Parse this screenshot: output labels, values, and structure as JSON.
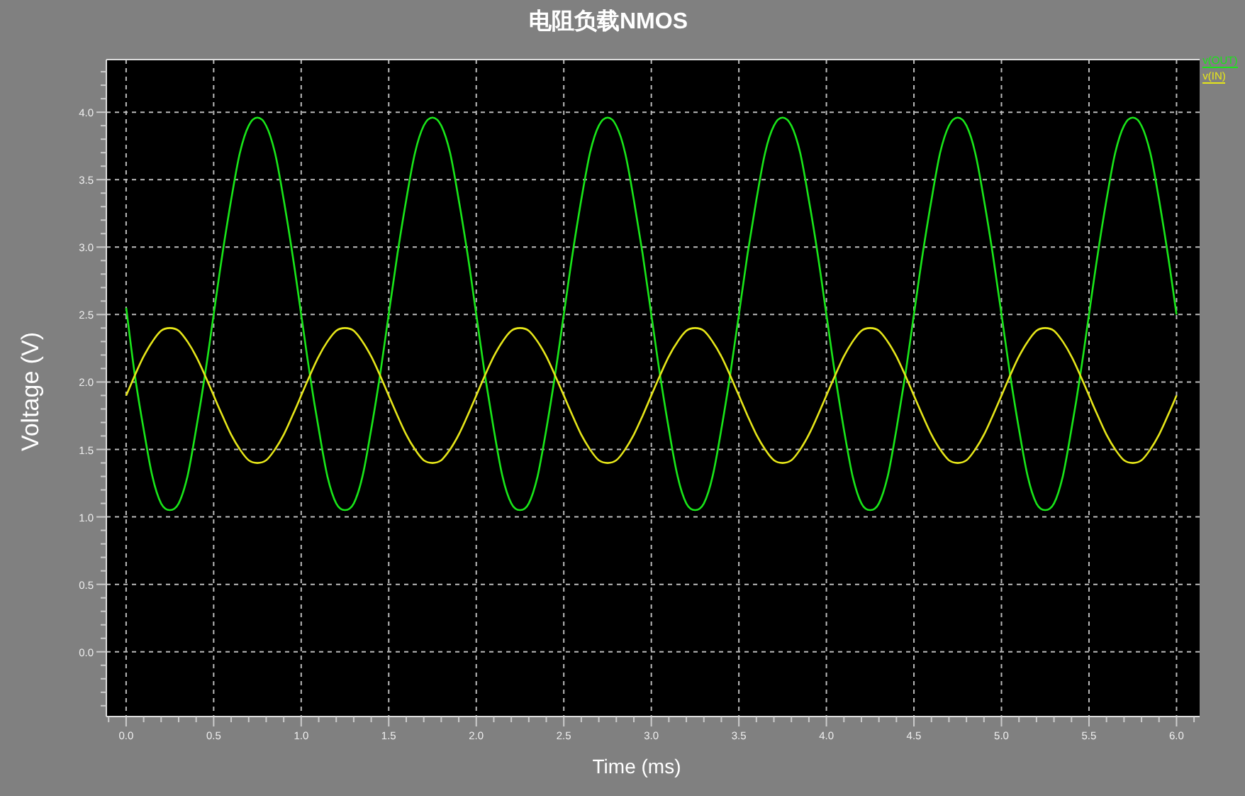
{
  "title": "电阻负载NMOS",
  "chart": {
    "chart_data": {
      "type": "line",
      "grid": true,
      "xlabel": "Time (ms)",
      "ylabel": "Voltage (V)",
      "xlim": [
        -0.113,
        6.14
      ],
      "ylim": [
        -0.48,
        4.39
      ],
      "xticks": [
        {
          "value": 0,
          "label": "0.0"
        },
        {
          "value": 0.5,
          "label": "0.5"
        },
        {
          "value": 1,
          "label": "1.0"
        },
        {
          "value": 1.5,
          "label": "1.5"
        },
        {
          "value": 2,
          "label": "2.0"
        },
        {
          "value": 2.5,
          "label": "2.5"
        },
        {
          "value": 3,
          "label": "3.0"
        },
        {
          "value": 3.5,
          "label": "3.5"
        },
        {
          "value": 4,
          "label": "4.0"
        },
        {
          "value": 4.5,
          "label": "4.5"
        },
        {
          "value": 5,
          "label": "5.0"
        },
        {
          "value": 5.5,
          "label": "5.5"
        },
        {
          "value": 6,
          "label": "6.0"
        }
      ],
      "yticks": [
        {
          "value": 0,
          "label": "0.0"
        },
        {
          "value": 0.5,
          "label": "0.5"
        },
        {
          "value": 1,
          "label": "1.0"
        },
        {
          "value": 1.5,
          "label": "1.5"
        },
        {
          "value": 2,
          "label": "2.0"
        },
        {
          "value": 2.5,
          "label": "2.5"
        },
        {
          "value": 3,
          "label": "3.0"
        },
        {
          "value": 3.5,
          "label": "3.5"
        },
        {
          "value": 4,
          "label": "4.0"
        }
      ],
      "x": [
        0,
        0.05,
        0.1,
        0.15,
        0.2,
        0.25,
        0.3,
        0.35,
        0.4,
        0.45,
        0.5,
        0.55,
        0.6,
        0.65,
        0.7,
        0.75,
        0.8,
        0.85,
        0.9,
        0.95,
        1,
        1.05,
        1.1,
        1.15,
        1.2,
        1.25,
        1.3,
        1.35,
        1.4,
        1.45,
        1.5,
        1.55,
        1.6,
        1.65,
        1.7,
        1.75,
        1.8,
        1.85,
        1.9,
        1.95,
        2,
        2.05,
        2.1,
        2.15,
        2.2,
        2.25,
        2.3,
        2.35,
        2.4,
        2.45,
        2.5,
        2.55,
        2.6,
        2.65,
        2.7,
        2.75,
        2.8,
        2.85,
        2.9,
        2.95,
        3,
        3.05,
        3.1,
        3.15,
        3.2,
        3.25,
        3.3,
        3.35,
        3.4,
        3.45,
        3.5,
        3.55,
        3.6,
        3.65,
        3.7,
        3.75,
        3.8,
        3.85,
        3.9,
        3.95,
        4,
        4.05,
        4.1,
        4.15,
        4.2,
        4.25,
        4.3,
        4.35,
        4.4,
        4.45,
        4.5,
        4.55,
        4.6,
        4.65,
        4.7,
        4.75,
        4.8,
        4.85,
        4.9,
        4.95,
        5,
        5.05,
        5.1,
        5.15,
        5.2,
        5.25,
        5.3,
        5.35,
        5.4,
        5.45,
        5.5,
        5.55,
        5.6,
        5.65,
        5.7,
        5.75,
        5.8,
        5.85,
        5.9,
        5.95,
        6
      ],
      "series": [
        {
          "name": "v(OUT)",
          "color": "#19e619",
          "values": [
            2.55,
            2.05,
            1.65,
            1.3,
            1.1,
            1.05,
            1.1,
            1.3,
            1.65,
            2.05,
            2.5,
            2.95,
            3.35,
            3.7,
            3.9,
            3.96,
            3.9,
            3.7,
            3.35,
            2.95,
            2.5,
            2.05,
            1.65,
            1.3,
            1.1,
            1.05,
            1.1,
            1.3,
            1.65,
            2.05,
            2.5,
            2.95,
            3.35,
            3.7,
            3.9,
            3.96,
            3.9,
            3.7,
            3.35,
            2.95,
            2.5,
            2.05,
            1.65,
            1.3,
            1.1,
            1.05,
            1.1,
            1.3,
            1.65,
            2.05,
            2.5,
            2.95,
            3.35,
            3.7,
            3.9,
            3.96,
            3.9,
            3.7,
            3.35,
            2.95,
            2.5,
            2.05,
            1.65,
            1.3,
            1.1,
            1.05,
            1.1,
            1.3,
            1.65,
            2.05,
            2.5,
            2.95,
            3.35,
            3.7,
            3.9,
            3.96,
            3.9,
            3.7,
            3.35,
            2.95,
            2.5,
            2.05,
            1.65,
            1.3,
            1.1,
            1.05,
            1.1,
            1.3,
            1.65,
            2.05,
            2.5,
            2.95,
            3.35,
            3.7,
            3.9,
            3.96,
            3.9,
            3.7,
            3.35,
            2.95,
            2.5,
            2.05,
            1.65,
            1.3,
            1.1,
            1.05,
            1.1,
            1.3,
            1.65,
            2.05,
            2.5,
            2.95,
            3.35,
            3.7,
            3.9,
            3.96,
            3.9,
            3.7,
            3.35,
            2.95,
            2.5
          ]
        },
        {
          "name": "v(IN)",
          "color": "#e6e619",
          "values": [
            1.9,
            2.05,
            2.19,
            2.3,
            2.38,
            2.4,
            2.38,
            2.3,
            2.19,
            2.05,
            1.9,
            1.75,
            1.61,
            1.5,
            1.42,
            1.4,
            1.42,
            1.5,
            1.61,
            1.75,
            1.9,
            2.05,
            2.19,
            2.3,
            2.38,
            2.4,
            2.38,
            2.3,
            2.19,
            2.05,
            1.9,
            1.75,
            1.61,
            1.5,
            1.42,
            1.4,
            1.42,
            1.5,
            1.61,
            1.75,
            1.9,
            2.05,
            2.19,
            2.3,
            2.38,
            2.4,
            2.38,
            2.3,
            2.19,
            2.05,
            1.9,
            1.75,
            1.61,
            1.5,
            1.42,
            1.4,
            1.42,
            1.5,
            1.61,
            1.75,
            1.9,
            2.05,
            2.19,
            2.3,
            2.38,
            2.4,
            2.38,
            2.3,
            2.19,
            2.05,
            1.9,
            1.75,
            1.61,
            1.5,
            1.42,
            1.4,
            1.42,
            1.5,
            1.61,
            1.75,
            1.9,
            2.05,
            2.19,
            2.3,
            2.38,
            2.4,
            2.38,
            2.3,
            2.19,
            2.05,
            1.9,
            1.75,
            1.61,
            1.5,
            1.42,
            1.4,
            1.42,
            1.5,
            1.61,
            1.75,
            1.9,
            2.05,
            2.19,
            2.3,
            2.38,
            2.4,
            2.38,
            2.3,
            2.19,
            2.05,
            1.9,
            1.75,
            1.61,
            1.5,
            1.42,
            1.4,
            1.42,
            1.5,
            1.61,
            1.75,
            1.9
          ]
        }
      ]
    }
  }
}
